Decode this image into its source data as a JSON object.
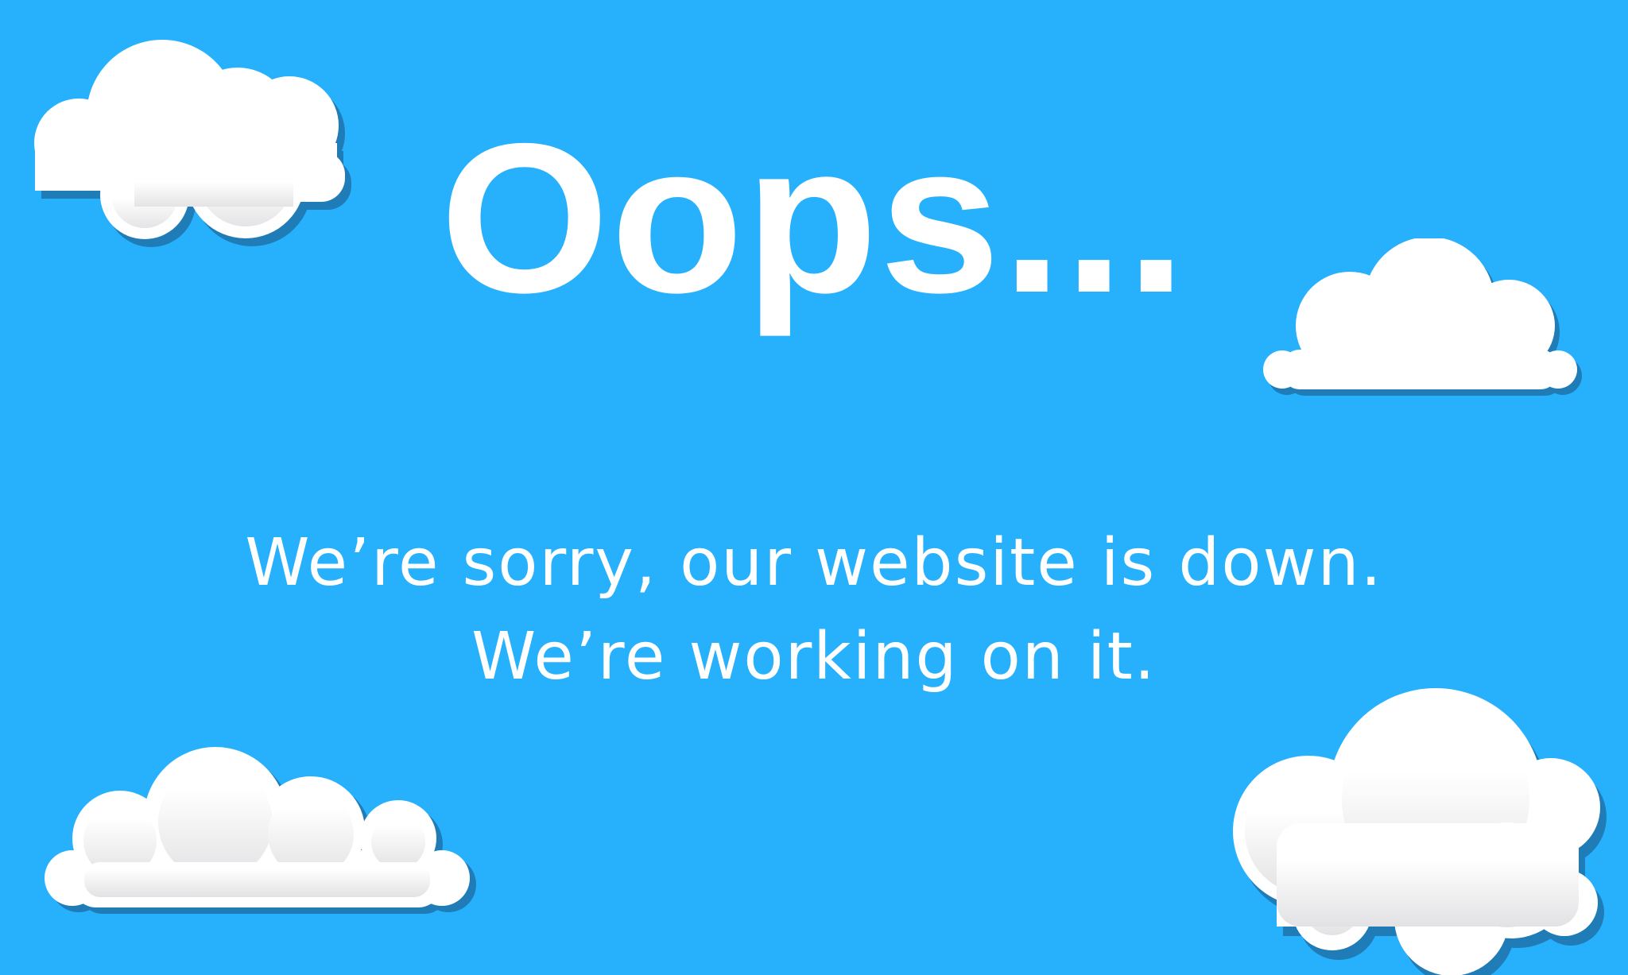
{
  "colors": {
    "background": "#27b1fd",
    "cloud_fill": "#ffffff",
    "cloud_shade": "#e6e6e8",
    "cloud_shadow": "#1f7cb7",
    "text": "#ffffff"
  },
  "headline": "Oops...",
  "message": {
    "line1": "We’re sorry, our website is down.",
    "line2": "We’re working on it."
  }
}
